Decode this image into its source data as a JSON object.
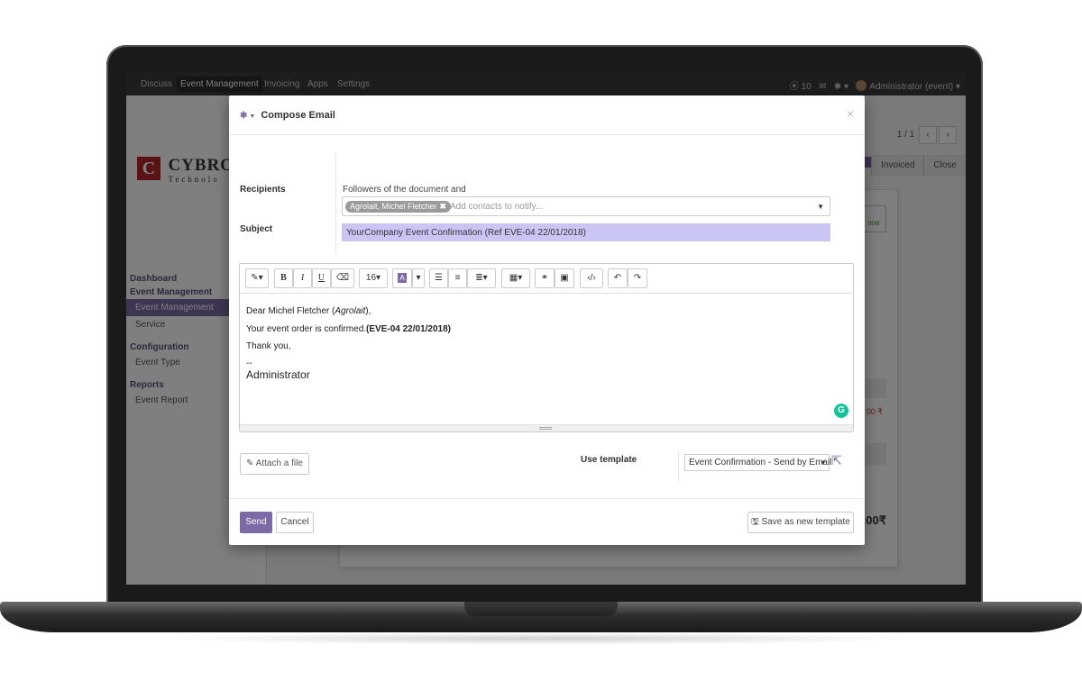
{
  "topbar": {
    "menu": [
      "Discuss",
      "Event Management",
      "Invoicing",
      "Apps",
      "Settings"
    ],
    "active_menu": "Event Management",
    "activity_count": "10",
    "user": "Administrator (event)"
  },
  "sidebar": {
    "logo_text": "CYBROS",
    "logo_subtext": "Technolo",
    "sections": [
      {
        "heading": "Dashboard"
      },
      {
        "heading": "Event Management",
        "items": [
          "Event Management",
          "Service"
        ]
      },
      {
        "heading": "Configuration",
        "items": [
          "Event Type"
        ]
      },
      {
        "heading": "Reports",
        "items": [
          "Event Report"
        ]
      }
    ]
  },
  "background": {
    "pager": "1 / 1",
    "status_steps": [
      "Invoiced",
      "Close"
    ],
    "done_badge": "one",
    "price_fragment": "00 ₹",
    "total_fragment": ".00₹"
  },
  "modal": {
    "title": "Compose Email",
    "recipients_label": "Recipients",
    "followers_text": "Followers of the document and",
    "recipient_tag": "Agrolait, Michel Fletcher",
    "recipients_placeholder": "Add contacts to notify...",
    "subject_label": "Subject",
    "subject_value": "YourCompany Event Confirmation (Ref EVE-04 22/01/2018)",
    "toolbar": {
      "font_size": "16",
      "bold": "B",
      "italic": "I",
      "underline": "U"
    },
    "body": {
      "greeting_prefix": "Dear Michel Fletcher (",
      "greeting_company": "Agrolait",
      "greeting_suffix": "),",
      "line2_text": "Your event order is confirmed.",
      "line2_ref": "(EVE-04 22/01/2018)",
      "thanks": "Thank you,",
      "sig_sep": "--",
      "signature": "Administrator"
    },
    "attach_label": "Attach a file",
    "use_template_label": "Use template",
    "template_value": "Event Confirmation - Send by Email",
    "send_label": "Send",
    "cancel_label": "Cancel",
    "save_template_label": "Save as new template"
  },
  "colors": {
    "accent": "#7c6aa6",
    "subject_highlight": "#c9c6f5",
    "grammarly": "#15c39a"
  }
}
